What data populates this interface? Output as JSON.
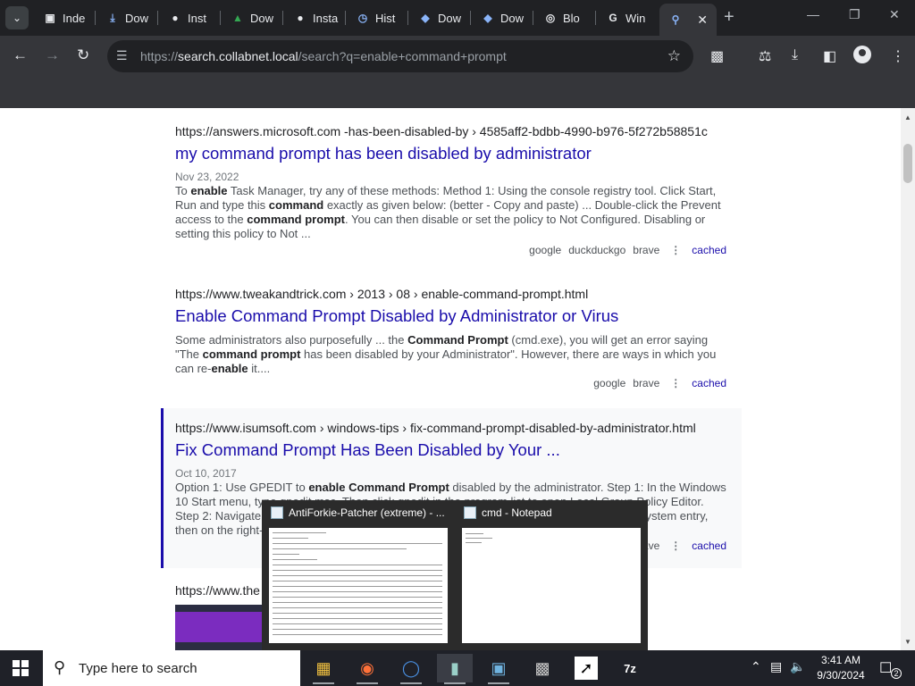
{
  "browser": {
    "tabs": [
      {
        "label": "Inde",
        "icon": "chrome-web-store-icon"
      },
      {
        "label": "Dow",
        "icon": "download-icon"
      },
      {
        "label": "Inst",
        "icon": "github-icon"
      },
      {
        "label": "Dow",
        "icon": "download-mountain-icon"
      },
      {
        "label": "Insta",
        "icon": "github-icon"
      },
      {
        "label": "Hist",
        "icon": "history-icon"
      },
      {
        "label": "Dow",
        "icon": "diamond-icon"
      },
      {
        "label": "Dow",
        "icon": "diamond-icon"
      },
      {
        "label": "Blo",
        "icon": "globe-icon"
      },
      {
        "label": "Win",
        "icon": "gm-icon"
      },
      {
        "label": "",
        "icon": "search-icon",
        "active": true
      }
    ],
    "url_prefix": "https://",
    "url_host": "search.collabnet.local",
    "url_path": "/search?q=enable+command+prompt"
  },
  "results": [
    {
      "url_host": "https://answers.microsoft.com",
      "url_path": " -has-been-disabled-by › 4585aff2-bdbb-4990-b976-5f272b58851c",
      "title": "my command prompt has been disabled by administrator",
      "date": "Nov 23, 2022",
      "snippet_html": "To <b>enable</b> Task Manager, try any of these methods: Method 1: Using the console registry tool. Click Start, Run and type this <b>command</b> exactly as given below: (better - Copy and paste) ... Double-click the Prevent access to the <b>command prompt</b>. You can then disable or set the policy to Not Configured. Disabling or setting this policy to Not ...",
      "engines": [
        "google",
        "duckduckgo",
        "brave"
      ],
      "cached": "cached"
    },
    {
      "url_host": "https://www.tweakandtrick.com",
      "url_path": " › 2013 › 08 › enable-command-prompt.html",
      "title": "Enable Command Prompt Disabled by Administrator or Virus",
      "date": "",
      "snippet_html": "Some administrators also purposefully ... the <b>Command Prompt</b> (cmd.exe), you will get an error saying \"The <b>command prompt</b> has been disabled by your Administrator\". However, there are ways in which you can re-<b>enable</b> it....",
      "engines": [
        "google",
        "brave"
      ],
      "cached": "cached"
    },
    {
      "url_host": "https://www.isumsoft.com",
      "url_path": " › windows-tips › fix-command-prompt-disabled-by-administrator.html",
      "title": "Fix Command Prompt Has Been Disabled by Your ...",
      "date": "Oct 10, 2017",
      "snippet_html": "Option 1: Use GPEDIT to <b>enable Command Prompt</b> disabled by the administrator. Step 1: In the Windows 10 Start menu, type gpedit.msc. Then click gpedit in the program list to open Local Group Policy Editor. Step 2: Navigate to User Configuration > Administrative Templates > System. Click on the System entry, then on the right-side pane ...",
      "engines": [
        "brave"
      ],
      "cached": "cached"
    },
    {
      "url_host": "https://www.the",
      "url_path": "",
      "title": "",
      "date": "",
      "snippet_html": "",
      "engines": [],
      "cached": ""
    }
  ],
  "taskbar_previews": [
    {
      "title": "AntiForkie-Patcher (extreme) - ..."
    },
    {
      "title": "cmd - Notepad"
    }
  ],
  "taskbar": {
    "search_placeholder": "Type here to search",
    "time": "3:41 AM",
    "date": "9/30/2024",
    "notifications": "2"
  }
}
